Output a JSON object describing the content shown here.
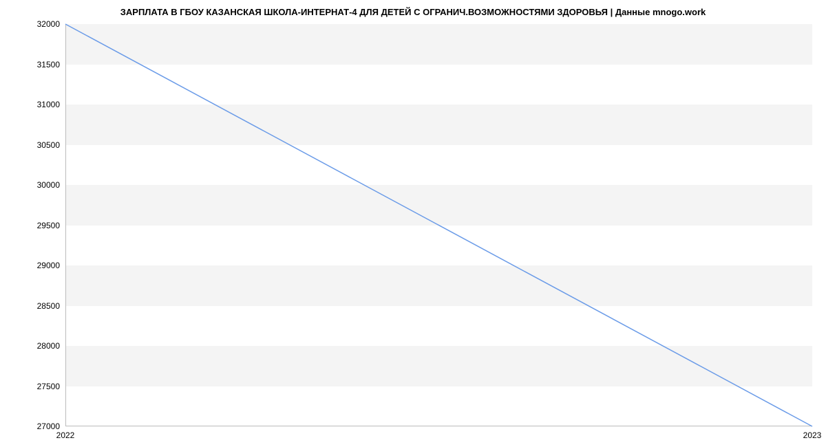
{
  "chart_data": {
    "type": "line",
    "title": "ЗАРПЛАТА В ГБОУ КАЗАНСКАЯ ШКОЛА-ИНТЕРНАТ-4 ДЛЯ ДЕТЕЙ С ОГРАНИЧ.ВОЗМОЖНОСТЯМИ ЗДОРОВЬЯ | Данные mnogo.work",
    "x": [
      2022,
      2023
    ],
    "values": [
      32000,
      27000
    ],
    "xlabel": "",
    "ylabel": "",
    "ylim": [
      27000,
      32000
    ],
    "y_ticks": [
      27000,
      27500,
      28000,
      28500,
      29000,
      29500,
      30000,
      30500,
      31000,
      31500,
      32000
    ],
    "x_ticks": [
      2022,
      2023
    ]
  }
}
